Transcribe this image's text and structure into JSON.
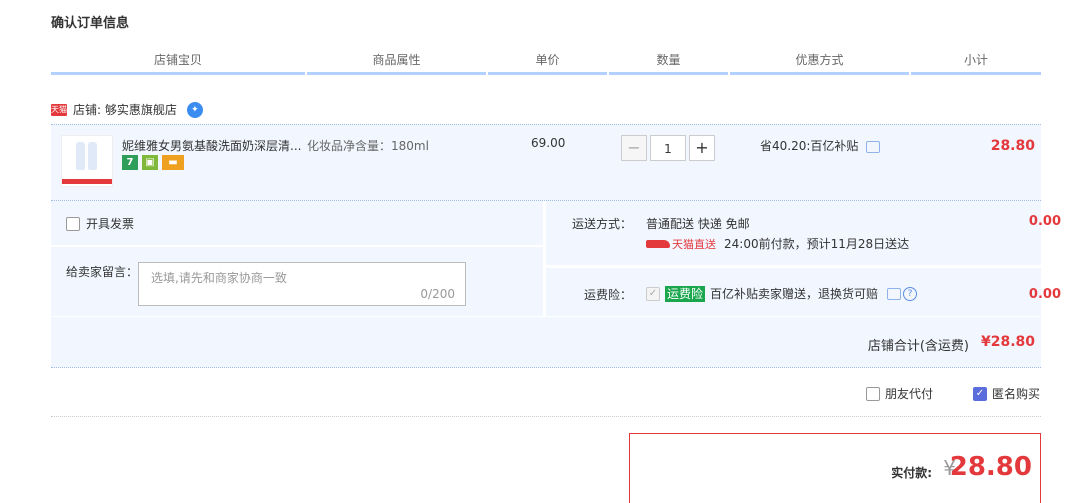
{
  "page_title": "确认订单信息",
  "columns": [
    "店铺宝贝",
    "商品属性",
    "单价",
    "数量",
    "优惠方式",
    "小计"
  ],
  "shop": {
    "badge": "天猫",
    "label": "店铺: 够实惠旗舰店"
  },
  "item": {
    "name": "妮维雅女男氨基酸洗面奶深层清...",
    "property": "化妆品净含量：180ml",
    "price": "69.00",
    "quantity": "1",
    "minus": "−",
    "plus": "+",
    "promo": "省40.20:百亿补贴",
    "subtotal": "28.80",
    "icon7": "7"
  },
  "invoice": {
    "label": "开具发票"
  },
  "message": {
    "label": "给卖家留言：",
    "placeholder": "选填,请先和商家协商一致",
    "counter": "0/200"
  },
  "shipping": {
    "label": "运送方式：",
    "value": "普通配送 快递 免邮",
    "tmall_tag": "天猫直送",
    "note": "24:00前付款，预计11月28日送达",
    "cost": "0.00"
  },
  "insurance": {
    "label": "运费险：",
    "badge": "运费险",
    "text": "百亿补贴卖家赠送，退换货可赔",
    "cost": "0.00"
  },
  "shop_total": {
    "label": "店铺合计(含运费)",
    "value": "¥28.80"
  },
  "options": {
    "friend_pay": "朋友代付",
    "anonymous": "匿名购买"
  },
  "payment": {
    "label": "实付款:",
    "currency": "¥",
    "amount": "28.80"
  }
}
